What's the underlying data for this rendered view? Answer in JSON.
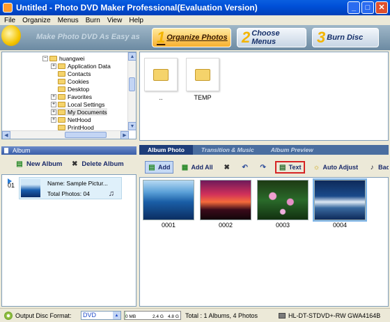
{
  "window": {
    "title": "Untitled - Photo DVD Maker Professional(Evaluation Version)"
  },
  "menu": [
    "File",
    "Organize",
    "Menus",
    "Burn",
    "View",
    "Help"
  ],
  "banner": {
    "slogan": "Make Photo DVD As Easy as",
    "steps": [
      {
        "num": "1",
        "label": "Organize Photos"
      },
      {
        "num": "2",
        "label": "Choose Menus"
      },
      {
        "num": "3",
        "label": "Burn Disc"
      }
    ]
  },
  "tree": {
    "root": "huangwei",
    "items": [
      {
        "label": "Application Data",
        "expandable": true
      },
      {
        "label": "Contacts",
        "expandable": false
      },
      {
        "label": "Cookies",
        "expandable": false
      },
      {
        "label": "Desktop",
        "expandable": false
      },
      {
        "label": "Favorites",
        "expandable": true
      },
      {
        "label": "Local Settings",
        "expandable": true
      },
      {
        "label": "My Documents",
        "expandable": true
      },
      {
        "label": "NetHood",
        "expandable": true
      },
      {
        "label": "PrintHood",
        "expandable": false
      }
    ]
  },
  "folders": [
    {
      "label": ".."
    },
    {
      "label": "TEMP"
    }
  ],
  "album": {
    "header": "Album",
    "new_label": "New Album",
    "delete_label": "Delete Album",
    "items": [
      {
        "num": "01",
        "name": "Name: Sample Pictur...",
        "total": "Total Photos: 04"
      }
    ]
  },
  "tabs": [
    "Album Photo",
    "Transition & Music",
    "Album Preview"
  ],
  "photo_toolbar": {
    "add": "Add",
    "add_all": "Add All",
    "text": "Text",
    "auto_adjust": "Auto Adjust",
    "back": "Back"
  },
  "photos": [
    {
      "label": "0001"
    },
    {
      "label": "0002"
    },
    {
      "label": "0003"
    },
    {
      "label": "0004"
    }
  ],
  "status": {
    "output_label": "Output Disc Format:",
    "format": "DVD",
    "gauge_ticks": [
      "0 MB",
      "2.4 G",
      "4.8 G"
    ],
    "total": "Total : 1 Albums, 4 Photos",
    "drive": "HL-DT-STDVD+-RW GWA4164B"
  }
}
